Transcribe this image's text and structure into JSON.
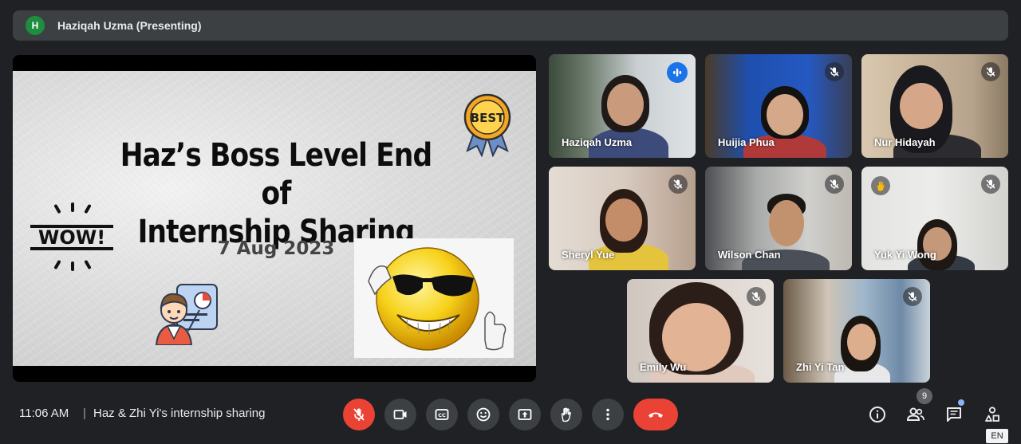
{
  "banner": {
    "avatar_initial": "H",
    "title": "Haziqah Uzma (Presenting)"
  },
  "slide": {
    "title_line1": "Haz’s Boss Level End of",
    "title_line2": "Internship Sharing",
    "date": "7 Aug 2023",
    "wow_text": "WOW!",
    "badge_text": "BEST"
  },
  "participants": [
    {
      "name": "Haziqah Uzma",
      "status": "speaking"
    },
    {
      "name": "Huijia Phua",
      "status": "muted"
    },
    {
      "name": "Nur Hidayah",
      "status": "muted"
    },
    {
      "name": "Sheryl Yue",
      "status": "muted"
    },
    {
      "name": "Wilson Chan",
      "status": "muted"
    },
    {
      "name": "Yuk Yi Wong",
      "status": "muted"
    },
    {
      "name": "Emily Wu",
      "status": "muted"
    },
    {
      "name": "Zhi Yi Tan",
      "status": "muted"
    }
  ],
  "bottom_bar": {
    "time": "11:06 AM",
    "separator": "|",
    "meeting_name": "Haz & Zhi Yi's internship sharing",
    "people_count": "9",
    "language": "EN"
  },
  "colors": {
    "background": "#202124",
    "surface": "#3c4043",
    "danger": "#ea4335",
    "accent": "#8ab4f8",
    "speaking": "#1a73e8"
  },
  "icons": {
    "controls": [
      "mic-off-icon",
      "camera-icon",
      "captions-icon",
      "emoji-icon",
      "present-icon",
      "raise-hand-icon",
      "more-options-icon",
      "end-call-icon"
    ],
    "right": [
      "info-icon",
      "people-icon",
      "chat-icon",
      "activities-icon"
    ]
  }
}
